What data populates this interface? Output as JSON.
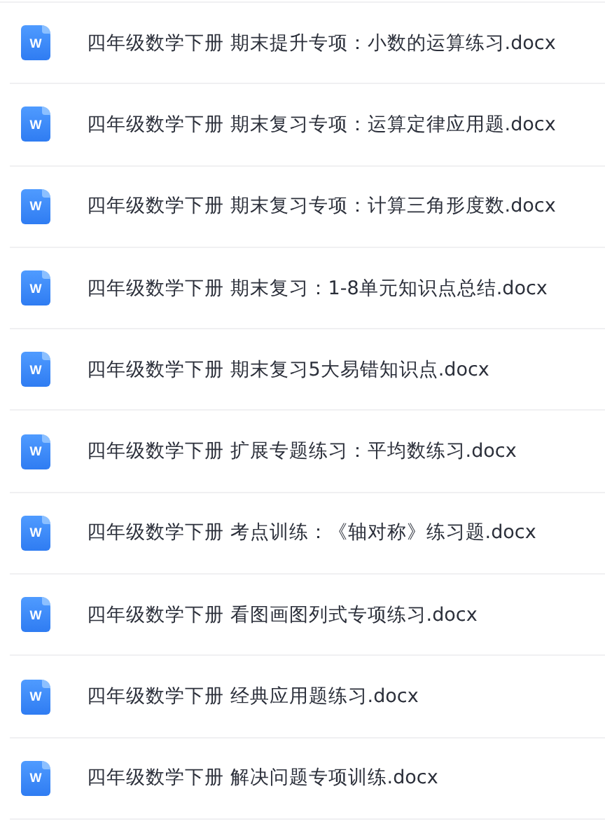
{
  "files": [
    {
      "name": "四年级数学下册 期末提升专项：小数的运算练习.docx",
      "icon_letter": "W"
    },
    {
      "name": "四年级数学下册 期末复习专项：运算定律应用题.docx",
      "icon_letter": "W"
    },
    {
      "name": "四年级数学下册 期末复习专项：计算三角形度数.docx",
      "icon_letter": "W"
    },
    {
      "name": "四年级数学下册 期末复习：1-8单元知识点总结.docx",
      "icon_letter": "W"
    },
    {
      "name": "四年级数学下册 期末复习5大易错知识点.docx",
      "icon_letter": "W"
    },
    {
      "name": "四年级数学下册 扩展专题练习：平均数练习.docx",
      "icon_letter": "W"
    },
    {
      "name": "四年级数学下册 考点训练：《轴对称》练习题.docx",
      "icon_letter": "W"
    },
    {
      "name": "四年级数学下册 看图画图列式专项练习.docx",
      "icon_letter": "W"
    },
    {
      "name": "四年级数学下册 经典应用题练习.docx",
      "icon_letter": "W"
    },
    {
      "name": "四年级数学下册 解决问题专项训练.docx",
      "icon_letter": "W"
    }
  ]
}
